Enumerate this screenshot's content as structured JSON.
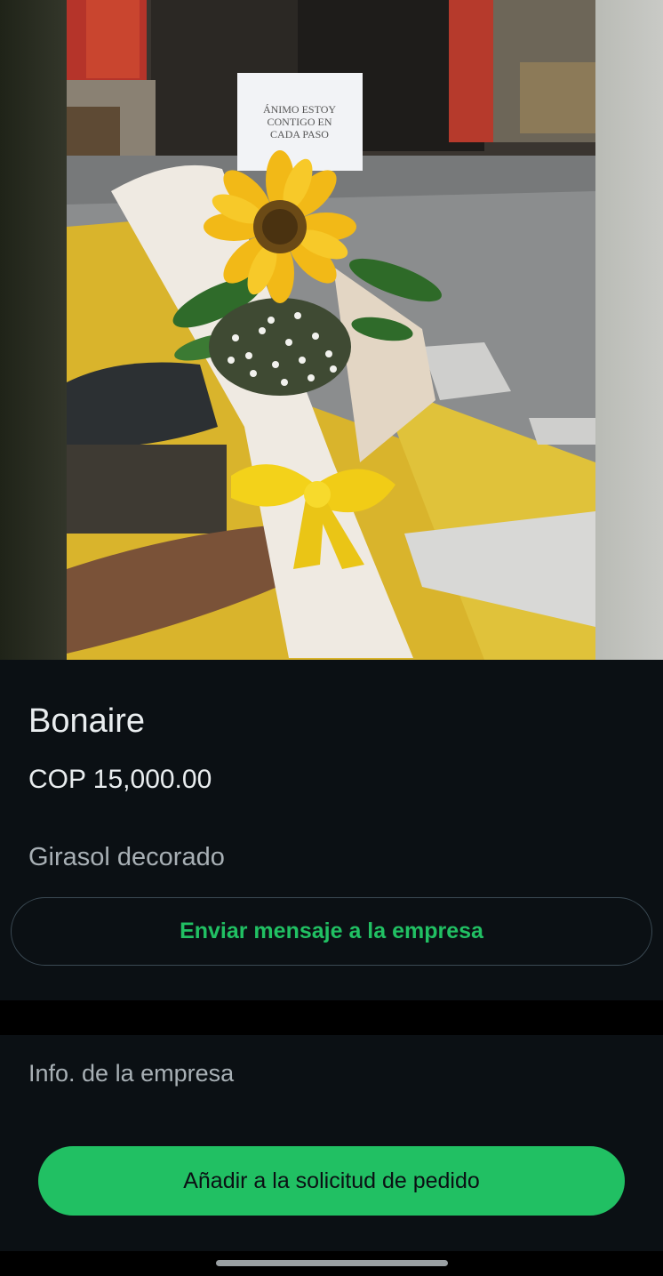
{
  "image": {
    "sign_text": [
      "ÁNIMO ESTOY",
      "CONTIGO EN",
      "CADA PASO"
    ]
  },
  "product": {
    "name": "Bonaire",
    "price": "COP 15,000.00",
    "description": "Girasol decorado"
  },
  "actions": {
    "message_label": "Enviar mensaje a la empresa",
    "add_order_label": "Añadir a la solicitud de pedido"
  },
  "business": {
    "info_label": "Info. de la empresa"
  },
  "colors": {
    "background": "#0b1014",
    "accent_green": "#21c063",
    "secondary_text": "#a8b0b5",
    "outline": "#3b4a54"
  }
}
